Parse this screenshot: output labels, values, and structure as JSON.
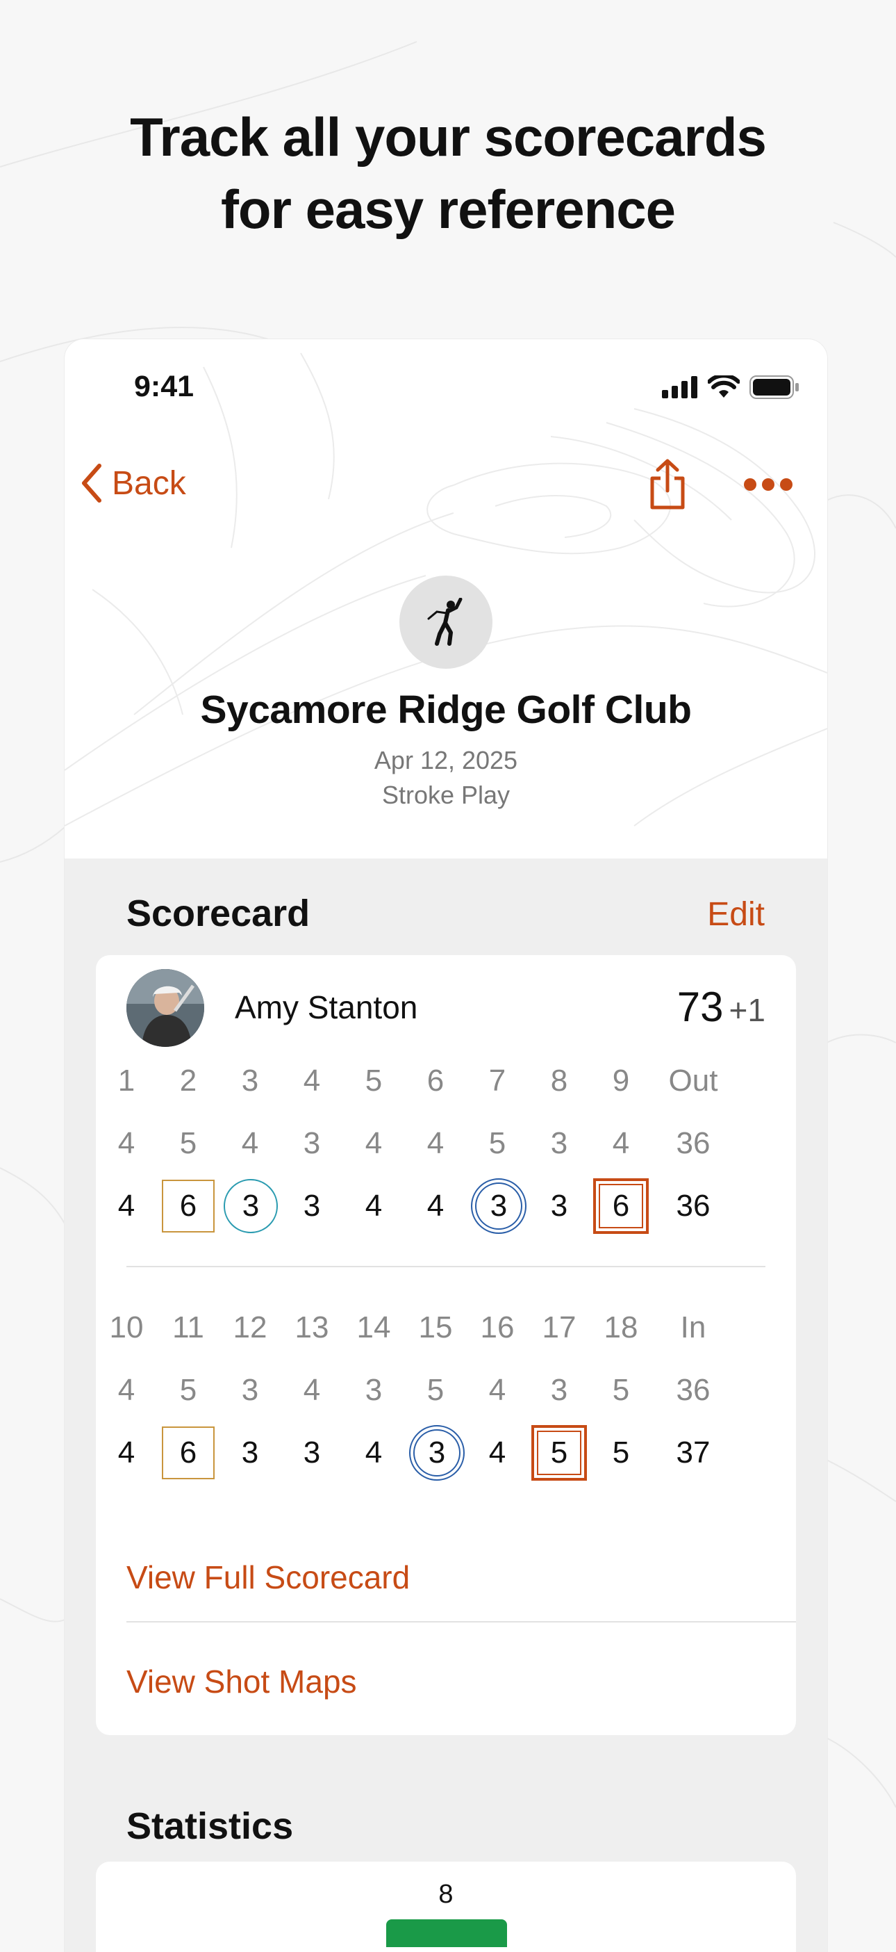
{
  "headline": {
    "line1": "Track all your scorecards",
    "line2": "for easy reference"
  },
  "status_bar": {
    "time": "9:41"
  },
  "nav": {
    "back_label": "Back",
    "icons": [
      "chevron-left-icon",
      "share-icon",
      "more-icon"
    ]
  },
  "course": {
    "name": "Sycamore Ridge Golf Club",
    "date": "Apr 12, 2025",
    "format": "Stroke Play",
    "icon": "golfer-icon"
  },
  "scorecard": {
    "title": "Scorecard",
    "edit_label": "Edit",
    "player": {
      "name": "Amy Stanton",
      "total": "73",
      "to_par": "+1"
    },
    "front": {
      "holes": [
        "1",
        "2",
        "3",
        "4",
        "5",
        "6",
        "7",
        "8",
        "9",
        "Out"
      ],
      "par": [
        "4",
        "5",
        "4",
        "3",
        "4",
        "4",
        "5",
        "3",
        "4",
        "36"
      ],
      "score": [
        "4",
        "6",
        "3",
        "3",
        "4",
        "4",
        "3",
        "3",
        "6",
        "36"
      ],
      "marks": [
        "",
        "bogey",
        "birdie",
        "",
        "",
        "",
        "eagle",
        "",
        "double",
        ""
      ]
    },
    "back": {
      "holes": [
        "10",
        "11",
        "12",
        "13",
        "14",
        "15",
        "16",
        "17",
        "18",
        "In"
      ],
      "par": [
        "4",
        "5",
        "3",
        "4",
        "3",
        "5",
        "4",
        "3",
        "5",
        "36"
      ],
      "score": [
        "4",
        "6",
        "3",
        "3",
        "4",
        "3",
        "4",
        "5",
        "5",
        "37"
      ],
      "marks": [
        "",
        "bogey",
        "",
        "",
        "",
        "eagle",
        "",
        "double",
        "",
        ""
      ]
    },
    "links": {
      "full": "View Full Scorecard",
      "shot_maps": "View Shot Maps"
    }
  },
  "statistics": {
    "title": "Statistics",
    "first_value": "8",
    "bar_color": "#1a9a48"
  },
  "colors": {
    "accent": "#c74b15",
    "bogey": "#c9953d",
    "birdie": "#2a9bb0",
    "eagle": "#2a5ea8"
  }
}
